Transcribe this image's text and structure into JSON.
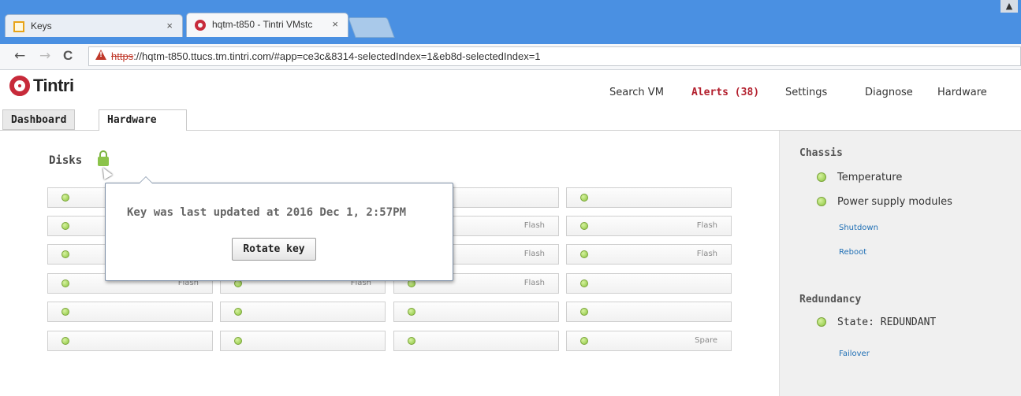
{
  "browser": {
    "tabs": [
      {
        "title": "Keys"
      },
      {
        "title": "hqtm-t850 - Tintri VMstc"
      }
    ],
    "close_glyph": "×",
    "url_protocol": "https",
    "url_rest": "://hqtm-t850.ttucs.tm.tintri.com/#app=ce3c&8314-selectedIndex=1&eb8d-selectedIndex=1",
    "back_glyph": "←",
    "forward_glyph": "→",
    "reload_glyph": "C"
  },
  "app": {
    "logo_text": "Tintri",
    "nav": {
      "search": "Search VM",
      "alerts": "Alerts (38)",
      "settings": "Settings",
      "diagnose": "Diagnose",
      "hardware": "Hardware"
    },
    "tabs": {
      "dashboard": "Dashboard",
      "hardware": "Hardware"
    }
  },
  "disks": {
    "title": "Disks",
    "labels": {
      "r2c4": "Flash",
      "r3c4": "Flash",
      "r4c1": "Flash",
      "r4c2": "Flash",
      "r4c3": "Flash",
      "r2c3": "Flash",
      "r3c3": "Flash",
      "r6c4": "Spare"
    }
  },
  "popover": {
    "message": "Key was last updated at 2016 Dec 1, 2:57PM",
    "button": "Rotate key"
  },
  "sidebar": {
    "chassis_title": "Chassis",
    "temperature": "Temperature",
    "power": "Power supply modules",
    "shutdown": "Shutdown",
    "reboot": "Reboot",
    "redundancy_title": "Redundancy",
    "state": "State: REDUNDANT",
    "failover": "Failover"
  },
  "colors": {
    "chrome_blue": "#4a90e2",
    "alert_red": "#b3202e",
    "led_green": "#8cc63f",
    "link_blue": "#1f6fb5",
    "brand_red": "#c72a3a"
  },
  "icons": [
    "keys-tab-icon",
    "tintri-tab-icon",
    "insecure-warning-icon",
    "lock-icon",
    "status-led-icon"
  ]
}
